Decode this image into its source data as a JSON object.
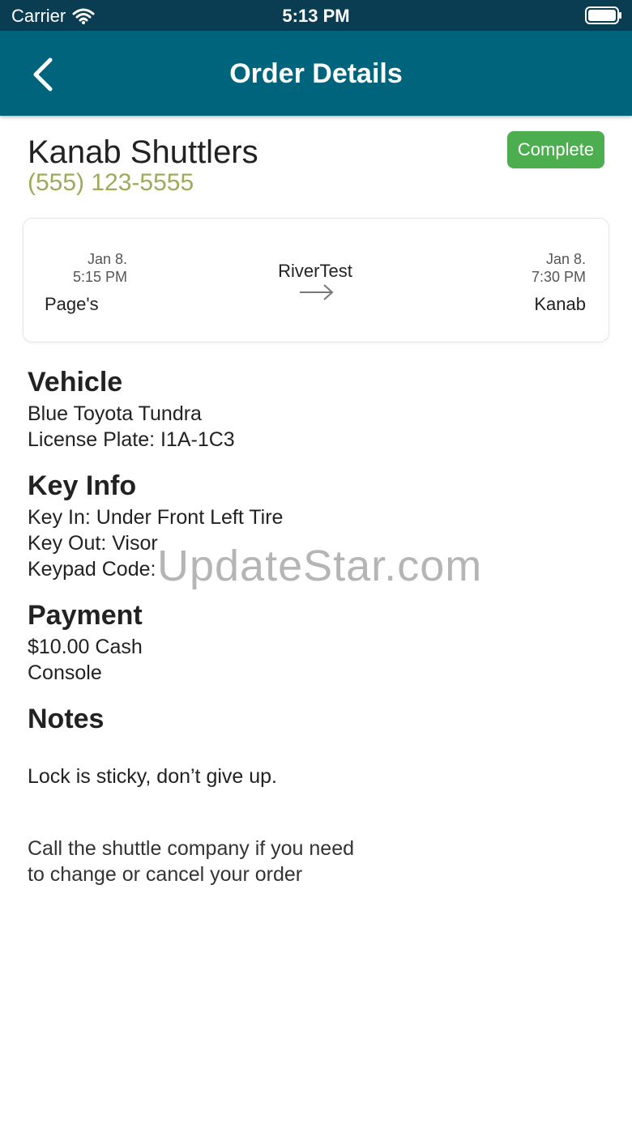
{
  "status_bar": {
    "carrier": "Carrier",
    "time": "5:13 PM",
    "icons": [
      "wifi-icon",
      "battery-icon"
    ]
  },
  "nav": {
    "title": "Order Details",
    "back_icon": "chevron-left-icon"
  },
  "order": {
    "company": "Kanab Shuttlers",
    "phone": "(555) 123-5555",
    "status": "Complete"
  },
  "trip": {
    "departure": {
      "date": "Jan 8.",
      "time": "5:15 PM",
      "place": "Page's"
    },
    "route": "RiverTest",
    "arrow_icon": "arrow-right-icon",
    "arrival": {
      "date": "Jan 8.",
      "time": "7:30 PM",
      "place": "Kanab"
    }
  },
  "vehicle": {
    "heading": "Vehicle",
    "description": "Blue Toyota Tundra",
    "license": "License Plate: I1A-1C3"
  },
  "key_info": {
    "heading": "Key Info",
    "key_in": "Key In: Under Front Left Tire",
    "key_out": "Key Out: Visor",
    "keypad": "Keypad Code:"
  },
  "payment": {
    "heading": "Payment",
    "amount": "$10.00 Cash",
    "location": "Console"
  },
  "notes": {
    "heading": "Notes",
    "text": "Lock is sticky, don’t give up."
  },
  "footer": {
    "line1": "Call the shuttle company if you need",
    "line2": "to change or cancel your order"
  },
  "watermark": "UpdateStar.com",
  "colors": {
    "status_bar": "#0a3d52",
    "nav_bar": "#00657c",
    "phone": "#9cab5a",
    "badge": "#4cae4f"
  }
}
